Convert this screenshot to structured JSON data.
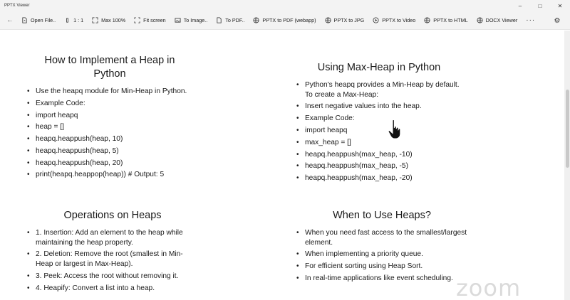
{
  "window": {
    "title": "PPTX Viewer"
  },
  "toolbar": {
    "items": [
      {
        "label": "Open File..",
        "icon": "file-open-icon"
      },
      {
        "label": "1 : 1",
        "icon": "actual-size-icon"
      },
      {
        "label": "Max 100%",
        "icon": "max-zoom-icon"
      },
      {
        "label": "Fit screen",
        "icon": "fit-screen-icon"
      },
      {
        "label": "To Image..",
        "icon": "image-icon"
      },
      {
        "label": "To PDF..",
        "icon": "pdf-icon"
      },
      {
        "label": "PPTX to PDF (webapp)",
        "icon": "globe-icon"
      },
      {
        "label": "PPTX to JPG",
        "icon": "globe-icon"
      },
      {
        "label": "PPTX to Video",
        "icon": "video-icon"
      },
      {
        "label": "PPTX to HTML",
        "icon": "globe-icon"
      },
      {
        "label": "DOCX Viewer",
        "icon": "globe-icon"
      }
    ],
    "more": "···"
  },
  "slides": {
    "heap_impl": {
      "title": "How to Implement a Heap in Python",
      "bullets": [
        "Use the heapq module for Min-Heap in Python.",
        "Example Code:",
        "import heapq",
        "heap = []",
        "heapq.heappush(heap, 10)",
        "heapq.heappush(heap, 5)",
        "heapq.heappush(heap, 20)",
        "print(heapq.heappop(heap))  # Output: 5"
      ]
    },
    "max_heap": {
      "title": "Using Max-Heap in Python",
      "bullets": [
        "Python's heapq provides a Min-Heap by default. To create a Max-Heap:",
        "Insert negative values into the heap.",
        "Example Code:",
        "import heapq",
        "max_heap = []",
        "heapq.heappush(max_heap, -10)",
        "heapq.heappush(max_heap, -5)",
        "heapq.heappush(max_heap, -20)"
      ]
    },
    "operations": {
      "title": "Operations on Heaps",
      "bullets": [
        "1. Insertion: Add an element to the heap while maintaining the heap property.",
        "2. Deletion: Remove the root (smallest in Min-Heap or largest in Max-Heap).",
        "3. Peek: Access the root without removing it.",
        "4. Heapify: Convert a list into a heap."
      ]
    },
    "when_to_use": {
      "title": "When to Use Heaps?",
      "bullets": [
        "When you need fast access to the smallest/largest element.",
        "When implementing a priority queue.",
        "For efficient sorting using Heap Sort.",
        "In real-time applications like event scheduling."
      ]
    }
  },
  "watermark": "zoom"
}
